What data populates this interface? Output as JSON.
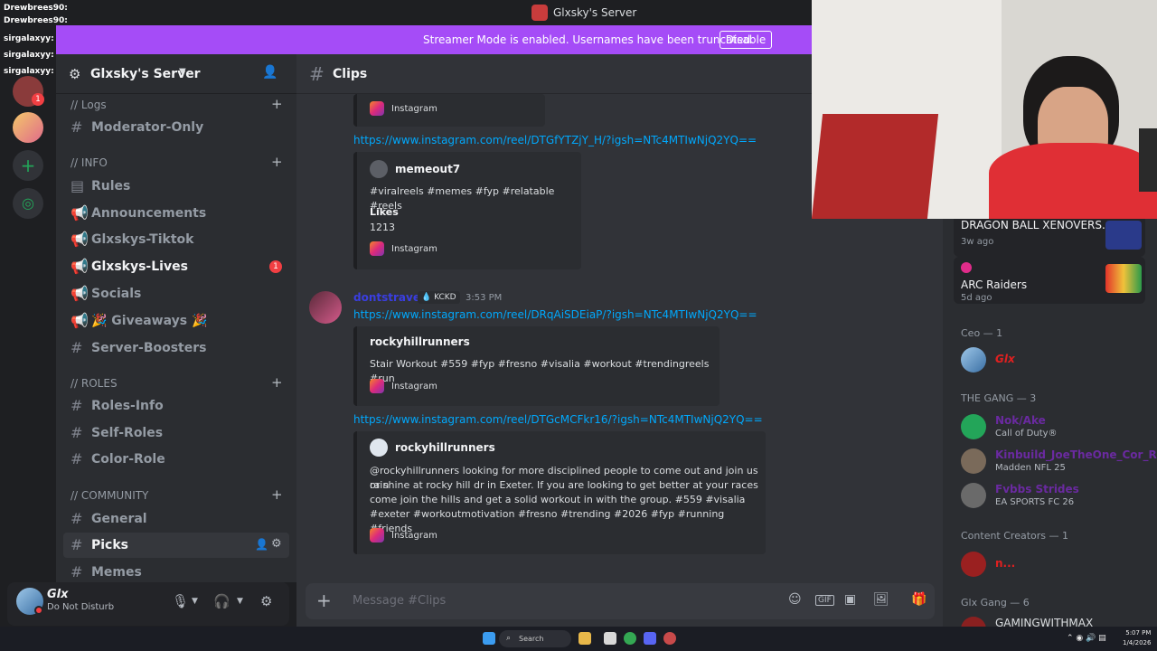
{
  "window": {
    "title": "Glxsky's Server"
  },
  "banner": {
    "message": "Streamer Mode is enabled. Usernames have been truncated.",
    "button": "Disable",
    "color": "#a54cf7"
  },
  "overlay_chat": [
    "Drewbrees90:",
    "Drewbrees90:",
    "sirgalaxyy:",
    "sirgalaxyy:",
    "sirgalaxyy:"
  ],
  "rail": {
    "mention_badge": "1"
  },
  "sidebar": {
    "server_name": "Glxsky's Server",
    "categories": {
      "logs": "// Logs",
      "info": "// INFO",
      "roles": "// ROLES",
      "community": "// COMMUNITY"
    },
    "channels": {
      "moderator_only": "Moderator-Only",
      "rules": "Rules",
      "announcements": "Announcements",
      "tiktok": "Glxskys-Tiktok",
      "lives": "Glxskys-Lives",
      "lives_badge": "1",
      "socials": "Socials",
      "giveaways": "🎉 Giveaways 🎉",
      "boosters": "Server-Boosters",
      "roles_info": "Roles-Info",
      "self_roles": "Self-Roles",
      "color_role": "Color-Role",
      "general": "General",
      "picks": "Picks",
      "memes": "Memes"
    }
  },
  "user_panel": {
    "name": "Glx",
    "status": "Do Not Disturb"
  },
  "chat": {
    "channel": "Clips",
    "embed0": {
      "provider": "Instagram"
    },
    "link1": "https://www.instagram.com/reel/DTGfYTZjY_H/?igsh=NTc4MTIwNjQ2YQ==",
    "embed1": {
      "author": "memeout7",
      "text": "#viralreels #memes #fyp #relatable #reels",
      "field_name": "Likes",
      "field_value": "1213",
      "provider": "Instagram"
    },
    "message2": {
      "author": "dontstrave",
      "tag": "KCKD",
      "time": "3:53 PM",
      "link": "https://www.instagram.com/reel/DRqAiSDEiaP/?igsh=NTc4MTIwNjQ2YQ=="
    },
    "embed2": {
      "author": "rockyhillrunners",
      "text": "Stair Workout #559 #fyp #fresno #visalia #workout #trendingreels #run",
      "provider": "Instagram"
    },
    "link3": "https://www.instagram.com/reel/DTGcMCFkr16/?igsh=NTc4MTIwNjQ2YQ==",
    "embed3": {
      "author": "rockyhillrunners",
      "text": [
        "@rockyhillrunners looking for more disciplined people to come out and join us rain",
        "or shine at rocky hill dr in Exeter. If you are looking to get better at your races",
        "come join the hills and get a solid workout in with the group. #559 #visalia",
        "#exeter #workoutmotivation #fresno #trending #2026 #fyp #running #friends"
      ],
      "provider": "Instagram"
    },
    "composer_placeholder": "Message #Clips"
  },
  "members": {
    "activity1": {
      "game": "DRAGON BALL XENOVERS...",
      "time": "3w ago"
    },
    "activity2": {
      "game": "ARC Raiders",
      "time": "5d ago"
    },
    "groups": {
      "ceo": "Ceo — 1",
      "gang": "THE GANG — 3",
      "creators": "Content Creators — 1",
      "glx_gang": "Glx Gang — 6"
    },
    "ceo_name": "Glx",
    "gang": [
      {
        "name": "Nok/Ake",
        "activity": "Call of Duty®"
      },
      {
        "name": "Kinbuild_JoeTheOne_Cor_Ra",
        "activity": "Madden NFL 25"
      },
      {
        "name": "Fvbbs Strides",
        "activity": "EA SPORTS FC 26"
      }
    ],
    "creator_name": "n...",
    "glx_gang_first": "GAMINGWITHMAX"
  },
  "taskbar": {
    "search": "Search",
    "time": "5:07 PM",
    "date": "1/4/2026"
  }
}
